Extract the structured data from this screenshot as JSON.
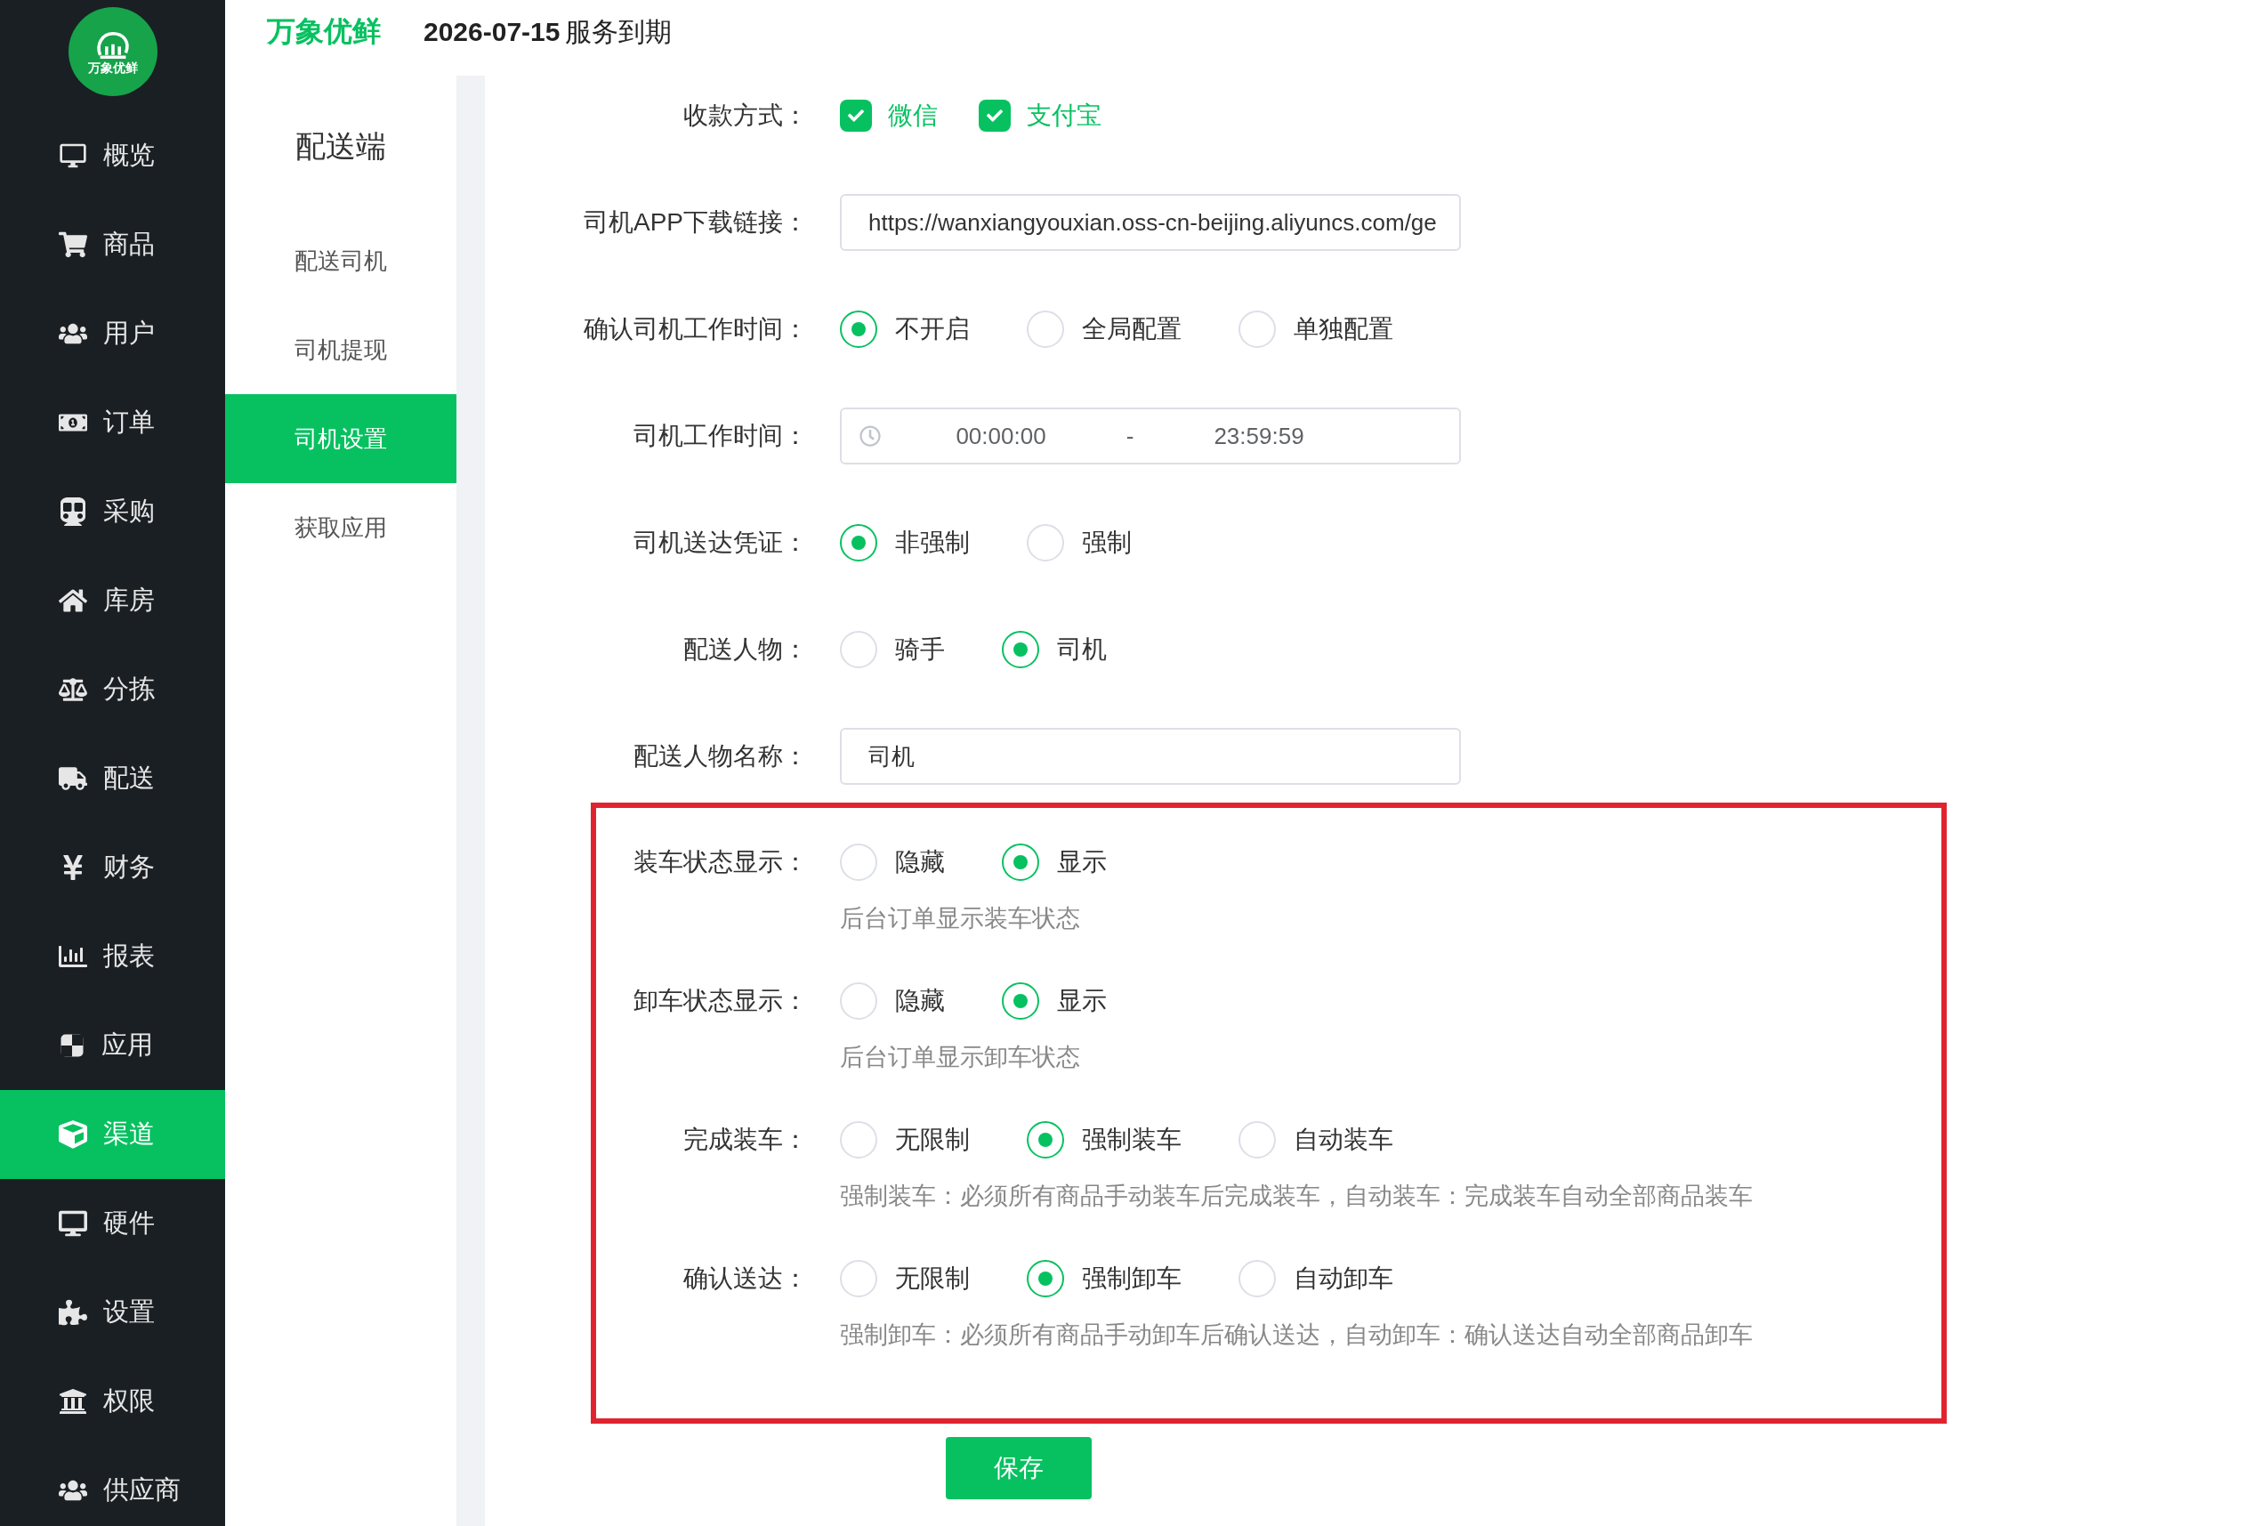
{
  "sidebar": {
    "logo_text": "万象优鲜",
    "items": [
      {
        "label": "概览",
        "selected": false
      },
      {
        "label": "商品",
        "selected": false
      },
      {
        "label": "用户",
        "selected": false
      },
      {
        "label": "订单",
        "selected": false
      },
      {
        "label": "采购",
        "selected": false
      },
      {
        "label": "库房",
        "selected": false
      },
      {
        "label": "分拣",
        "selected": false
      },
      {
        "label": "配送",
        "selected": false
      },
      {
        "label": "财务",
        "selected": false
      },
      {
        "label": "报表",
        "selected": false
      },
      {
        "label": "应用",
        "selected": false
      },
      {
        "label": "渠道",
        "selected": true
      },
      {
        "label": "硬件",
        "selected": false
      },
      {
        "label": "设置",
        "selected": false
      },
      {
        "label": "权限",
        "selected": false
      },
      {
        "label": "供应商",
        "selected": false
      }
    ]
  },
  "header": {
    "brand": "万象优鲜",
    "expiry_date": "2026-07-15",
    "expiry_label": "服务到期"
  },
  "submenu": {
    "title": "配送端",
    "items": [
      {
        "label": "配送司机",
        "selected": false
      },
      {
        "label": "司机提现",
        "selected": false
      },
      {
        "label": "司机设置",
        "selected": true
      },
      {
        "label": "获取应用",
        "selected": false
      }
    ]
  },
  "form": {
    "fields": [
      {
        "kind": "checkboxes",
        "label": "收款方式：",
        "options": [
          {
            "label": "微信",
            "checked": true
          },
          {
            "label": "支付宝",
            "checked": true
          }
        ]
      },
      {
        "kind": "text",
        "label": "司机APP下载链接：",
        "value": "https://wanxiangyouxian.oss-cn-beijing.aliyuncs.com/ge"
      },
      {
        "kind": "radio",
        "label": "确认司机工作时间：",
        "options": [
          {
            "label": "不开启",
            "selected": true
          },
          {
            "label": "全局配置",
            "selected": false
          },
          {
            "label": "单独配置",
            "selected": false
          }
        ]
      },
      {
        "kind": "time_range",
        "label": "司机工作时间：",
        "start": "00:00:00",
        "separator": "-",
        "end": "23:59:59"
      },
      {
        "kind": "radio",
        "label": "司机送达凭证：",
        "options": [
          {
            "label": "非强制",
            "selected": true
          },
          {
            "label": "强制",
            "selected": false
          }
        ]
      },
      {
        "kind": "radio",
        "label": "配送人物：",
        "options": [
          {
            "label": "骑手",
            "selected": false
          },
          {
            "label": "司机",
            "selected": true
          }
        ]
      },
      {
        "kind": "text",
        "label": "配送人物名称：",
        "value": "司机"
      }
    ],
    "highlighted_fields": [
      {
        "label": "装车状态显示：",
        "options": [
          {
            "label": "隐藏",
            "selected": false
          },
          {
            "label": "显示",
            "selected": true
          }
        ],
        "help": "后台订单显示装车状态"
      },
      {
        "label": "卸车状态显示：",
        "options": [
          {
            "label": "隐藏",
            "selected": false
          },
          {
            "label": "显示",
            "selected": true
          }
        ],
        "help": "后台订单显示卸车状态"
      },
      {
        "label": "完成装车：",
        "options": [
          {
            "label": "无限制",
            "selected": false
          },
          {
            "label": "强制装车",
            "selected": true
          },
          {
            "label": "自动装车",
            "selected": false
          }
        ],
        "help": "强制装车：必须所有商品手动装车后完成装车，自动装车：完成装车自动全部商品装车"
      },
      {
        "label": "确认送达：",
        "options": [
          {
            "label": "无限制",
            "selected": false
          },
          {
            "label": "强制卸车",
            "selected": true
          },
          {
            "label": "自动卸车",
            "selected": false
          }
        ],
        "help": "强制卸车：必须所有商品手动卸车后确认送达，自动卸车：确认送达自动全部商品卸车"
      }
    ],
    "save_button": "保存"
  }
}
